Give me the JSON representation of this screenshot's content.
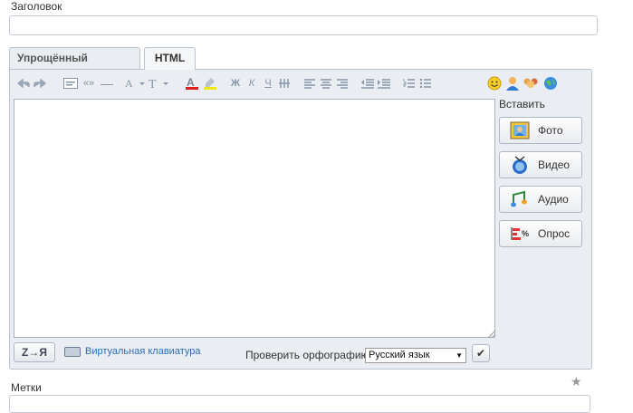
{
  "title_field": {
    "label": "Заголовок",
    "value": ""
  },
  "tabs": [
    {
      "label": "Упрощённый формат",
      "active": false
    },
    {
      "label": "HTML",
      "active": true
    }
  ],
  "toolbar": {
    "icons": [
      "undo-icon",
      "redo-icon",
      "smiley-code-icon",
      "quote-icon",
      "dash-icon",
      "font-face-icon",
      "font-size-icon",
      "text-color-icon",
      "highlight-icon",
      "bold-icon",
      "italic-icon",
      "underline-icon",
      "strikethrough-icon",
      "align-left-icon",
      "align-center-icon",
      "align-right-icon",
      "outdent-icon",
      "indent-icon",
      "numbered-list-icon",
      "bullet-list-icon",
      "emoticon-icon",
      "user-icon",
      "community-icon",
      "globe-icon"
    ],
    "glyphs": {
      "quote": "«»",
      "dash": "—",
      "bold": "Ж",
      "italic": "К",
      "underline": "Ч"
    }
  },
  "editor": {
    "content": ""
  },
  "insert_panel": {
    "title": "Вставить",
    "buttons": [
      {
        "label": "Фото",
        "icon": "photo-icon"
      },
      {
        "label": "Видео",
        "icon": "video-icon"
      },
      {
        "label": "Аудио",
        "icon": "audio-icon"
      },
      {
        "label": "Опрос",
        "icon": "poll-icon"
      }
    ]
  },
  "bottom": {
    "zya_label": "Z→Я",
    "keyboard_link": "Виртуальная клавиатура",
    "spell_label": "Проверить орфографию",
    "spell_language": "Русский язык",
    "spell_check_glyph": "✔"
  },
  "tags_field": {
    "label": "Метки",
    "value": ""
  },
  "colors": {
    "frame": "#eaedf1",
    "border": "#b9c4cf",
    "link": "#2a6fb8"
  }
}
